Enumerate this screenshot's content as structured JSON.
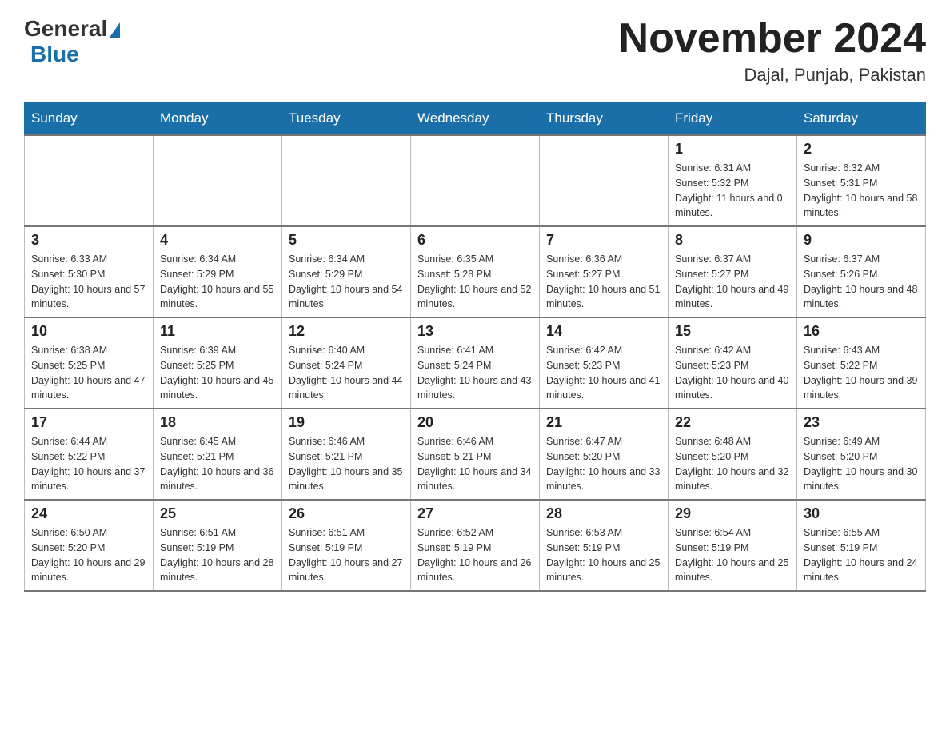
{
  "header": {
    "logo_general": "General",
    "logo_blue": "Blue",
    "month_title": "November 2024",
    "location": "Dajal, Punjab, Pakistan"
  },
  "weekdays": [
    "Sunday",
    "Monday",
    "Tuesday",
    "Wednesday",
    "Thursday",
    "Friday",
    "Saturday"
  ],
  "weeks": [
    [
      {
        "day": "",
        "info": ""
      },
      {
        "day": "",
        "info": ""
      },
      {
        "day": "",
        "info": ""
      },
      {
        "day": "",
        "info": ""
      },
      {
        "day": "",
        "info": ""
      },
      {
        "day": "1",
        "info": "Sunrise: 6:31 AM\nSunset: 5:32 PM\nDaylight: 11 hours and 0 minutes."
      },
      {
        "day": "2",
        "info": "Sunrise: 6:32 AM\nSunset: 5:31 PM\nDaylight: 10 hours and 58 minutes."
      }
    ],
    [
      {
        "day": "3",
        "info": "Sunrise: 6:33 AM\nSunset: 5:30 PM\nDaylight: 10 hours and 57 minutes."
      },
      {
        "day": "4",
        "info": "Sunrise: 6:34 AM\nSunset: 5:29 PM\nDaylight: 10 hours and 55 minutes."
      },
      {
        "day": "5",
        "info": "Sunrise: 6:34 AM\nSunset: 5:29 PM\nDaylight: 10 hours and 54 minutes."
      },
      {
        "day": "6",
        "info": "Sunrise: 6:35 AM\nSunset: 5:28 PM\nDaylight: 10 hours and 52 minutes."
      },
      {
        "day": "7",
        "info": "Sunrise: 6:36 AM\nSunset: 5:27 PM\nDaylight: 10 hours and 51 minutes."
      },
      {
        "day": "8",
        "info": "Sunrise: 6:37 AM\nSunset: 5:27 PM\nDaylight: 10 hours and 49 minutes."
      },
      {
        "day": "9",
        "info": "Sunrise: 6:37 AM\nSunset: 5:26 PM\nDaylight: 10 hours and 48 minutes."
      }
    ],
    [
      {
        "day": "10",
        "info": "Sunrise: 6:38 AM\nSunset: 5:25 PM\nDaylight: 10 hours and 47 minutes."
      },
      {
        "day": "11",
        "info": "Sunrise: 6:39 AM\nSunset: 5:25 PM\nDaylight: 10 hours and 45 minutes."
      },
      {
        "day": "12",
        "info": "Sunrise: 6:40 AM\nSunset: 5:24 PM\nDaylight: 10 hours and 44 minutes."
      },
      {
        "day": "13",
        "info": "Sunrise: 6:41 AM\nSunset: 5:24 PM\nDaylight: 10 hours and 43 minutes."
      },
      {
        "day": "14",
        "info": "Sunrise: 6:42 AM\nSunset: 5:23 PM\nDaylight: 10 hours and 41 minutes."
      },
      {
        "day": "15",
        "info": "Sunrise: 6:42 AM\nSunset: 5:23 PM\nDaylight: 10 hours and 40 minutes."
      },
      {
        "day": "16",
        "info": "Sunrise: 6:43 AM\nSunset: 5:22 PM\nDaylight: 10 hours and 39 minutes."
      }
    ],
    [
      {
        "day": "17",
        "info": "Sunrise: 6:44 AM\nSunset: 5:22 PM\nDaylight: 10 hours and 37 minutes."
      },
      {
        "day": "18",
        "info": "Sunrise: 6:45 AM\nSunset: 5:21 PM\nDaylight: 10 hours and 36 minutes."
      },
      {
        "day": "19",
        "info": "Sunrise: 6:46 AM\nSunset: 5:21 PM\nDaylight: 10 hours and 35 minutes."
      },
      {
        "day": "20",
        "info": "Sunrise: 6:46 AM\nSunset: 5:21 PM\nDaylight: 10 hours and 34 minutes."
      },
      {
        "day": "21",
        "info": "Sunrise: 6:47 AM\nSunset: 5:20 PM\nDaylight: 10 hours and 33 minutes."
      },
      {
        "day": "22",
        "info": "Sunrise: 6:48 AM\nSunset: 5:20 PM\nDaylight: 10 hours and 32 minutes."
      },
      {
        "day": "23",
        "info": "Sunrise: 6:49 AM\nSunset: 5:20 PM\nDaylight: 10 hours and 30 minutes."
      }
    ],
    [
      {
        "day": "24",
        "info": "Sunrise: 6:50 AM\nSunset: 5:20 PM\nDaylight: 10 hours and 29 minutes."
      },
      {
        "day": "25",
        "info": "Sunrise: 6:51 AM\nSunset: 5:19 PM\nDaylight: 10 hours and 28 minutes."
      },
      {
        "day": "26",
        "info": "Sunrise: 6:51 AM\nSunset: 5:19 PM\nDaylight: 10 hours and 27 minutes."
      },
      {
        "day": "27",
        "info": "Sunrise: 6:52 AM\nSunset: 5:19 PM\nDaylight: 10 hours and 26 minutes."
      },
      {
        "day": "28",
        "info": "Sunrise: 6:53 AM\nSunset: 5:19 PM\nDaylight: 10 hours and 25 minutes."
      },
      {
        "day": "29",
        "info": "Sunrise: 6:54 AM\nSunset: 5:19 PM\nDaylight: 10 hours and 25 minutes."
      },
      {
        "day": "30",
        "info": "Sunrise: 6:55 AM\nSunset: 5:19 PM\nDaylight: 10 hours and 24 minutes."
      }
    ]
  ]
}
